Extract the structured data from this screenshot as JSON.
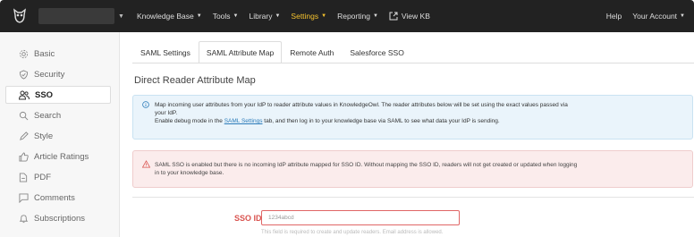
{
  "topbar": {
    "nav": [
      {
        "label": "Knowledge Base",
        "caret": true,
        "active": false
      },
      {
        "label": "Tools",
        "caret": true,
        "active": false
      },
      {
        "label": "Library",
        "caret": true,
        "active": false
      },
      {
        "label": "Settings",
        "caret": true,
        "active": true
      },
      {
        "label": "Reporting",
        "caret": true,
        "active": false
      }
    ],
    "view_kb": "View KB",
    "help": "Help",
    "account": "Your Account"
  },
  "sidebar": {
    "items": [
      {
        "label": "Basic",
        "icon": "gear-icon"
      },
      {
        "label": "Security",
        "icon": "shield-icon"
      },
      {
        "label": "SSO",
        "icon": "users-icon",
        "active": true
      },
      {
        "label": "Search",
        "icon": "search-icon"
      },
      {
        "label": "Style",
        "icon": "pen-icon"
      },
      {
        "label": "Article Ratings",
        "icon": "thumbs-up-icon"
      },
      {
        "label": "PDF",
        "icon": "file-icon"
      },
      {
        "label": "Comments",
        "icon": "comment-icon"
      },
      {
        "label": "Subscriptions",
        "icon": "bell-icon"
      }
    ]
  },
  "main": {
    "tabs": [
      "SAML Settings",
      "SAML Attribute Map",
      "Remote Auth",
      "Salesforce SSO"
    ],
    "active_tab": 1,
    "heading": "Direct Reader Attribute Map",
    "info": {
      "line1": "Map incoming user attributes from your IdP to reader attribute values in KnowledgeOwl. The reader attributes below will be set using the exact values passed via",
      "line2": "your IdP.",
      "line3_pre": "Enable debug mode in the ",
      "line3_link": "SAML Settings",
      "line3_post": " tab, and then log in to your knowledge base via SAML to see what data your IdP is sending."
    },
    "warning": {
      "line1": "SAML SSO is enabled but there is no incoming IdP attribute mapped for SSO ID. Without mapping the SSO ID, readers will not get created or updated when logging",
      "line2": "in to your knowledge base."
    },
    "sso_field": {
      "label": "SSO ID",
      "value": "1234abcd",
      "help": "This field is required to create and update readers. Email address is allowed."
    }
  },
  "colors": {
    "topbar_bg": "#222222",
    "active_nav": "#f5c22e",
    "error": "#d9534f",
    "info_bg": "#eaf4fb",
    "warn_bg": "#fbecec",
    "link": "#2b7bb9"
  }
}
